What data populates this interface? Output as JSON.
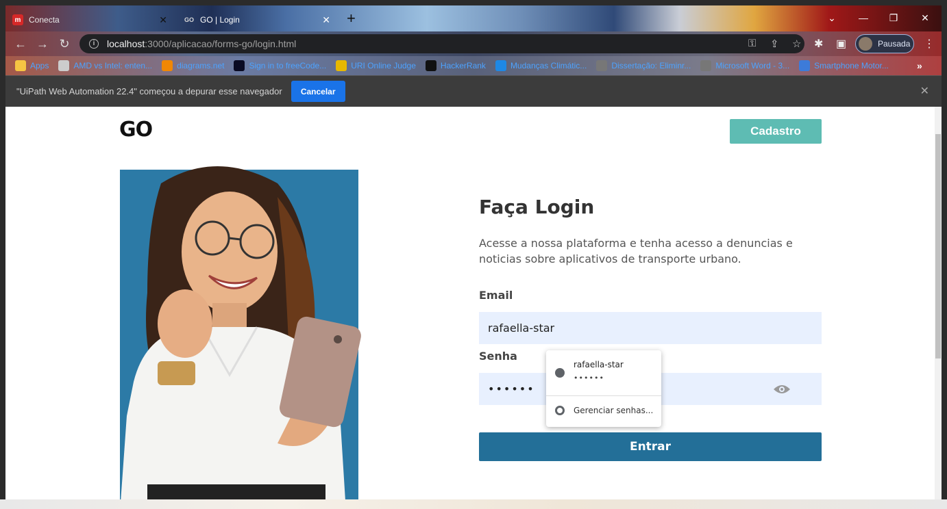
{
  "browser": {
    "tabs": [
      {
        "title": "Conecta",
        "favicon": "m"
      },
      {
        "title": "GO | Login",
        "favicon": "GO"
      }
    ],
    "address": {
      "host": "localhost",
      "path": ":3000/aplicacao/forms-go/login.html"
    },
    "profile_label": "Pausada",
    "bookmarks": [
      {
        "label": "Apps",
        "icon": "apps-grid-icon",
        "color": "#f6c543"
      },
      {
        "label": "AMD vs Intel: enten...",
        "icon": "page-icon",
        "color": "#cccccc"
      },
      {
        "label": "diagrams.net",
        "icon": "diagrams-icon",
        "color": "#f08705"
      },
      {
        "label": "Sign in to freeCode...",
        "icon": "freecodecamp-icon",
        "color": "#0a0a23"
      },
      {
        "label": "URI Online Judge",
        "icon": "trophy-icon",
        "color": "#e6b800"
      },
      {
        "label": "HackerRank",
        "icon": "hackerrank-icon",
        "color": "#111111"
      },
      {
        "label": "Mudanças Climátic...",
        "icon": "refresh-icon",
        "color": "#1e88e5"
      },
      {
        "label": "Dissertação: Eliminr...",
        "icon": "globe-icon",
        "color": "#777777"
      },
      {
        "label": "Microsoft Word - 3...",
        "icon": "globe-icon",
        "color": "#777777"
      },
      {
        "label": "Smartphone Motor...",
        "icon": "phone-icon",
        "color": "#3d7bd9"
      }
    ],
    "more_bookmarks": "»"
  },
  "infobar": {
    "message": "\"UiPath Web Automation 22.4\" começou a depurar esse navegador",
    "cancel_label": "Cancelar"
  },
  "page": {
    "logo": "GO",
    "signup_label": "Cadastro",
    "title": "Faça Login",
    "description": "Acesse a nossa plataforma e tenha acesso a denuncias e noticias sobre aplicativos de transporte urbano.",
    "email_label": "Email",
    "email_value": "rafaella-star",
    "password_label": "Senha",
    "password_value": "••••••",
    "submit_label": "Entrar",
    "colors": {
      "signup": "#5ebcb3",
      "submit": "#236f98",
      "field_bg": "#e8f0fe",
      "hero_bg": "#2c7aa6"
    }
  },
  "autofill": {
    "username": "rafaella-star",
    "password_mask": "••••••",
    "manage_label": "Gerenciar senhas..."
  }
}
